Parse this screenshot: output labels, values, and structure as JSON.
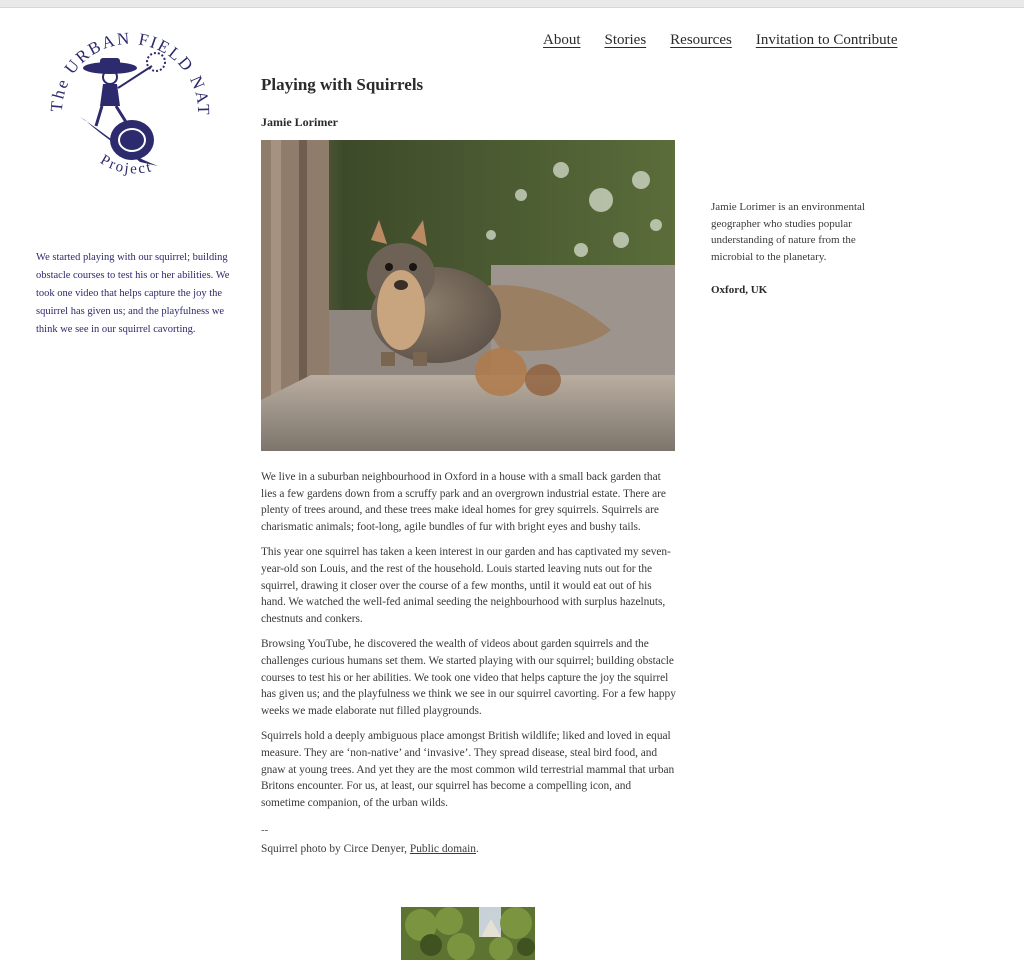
{
  "logo": {
    "arc_top": "The URBAN FIELD NATURALIST",
    "arc_bottom": "Project",
    "colors": {
      "ink": "#2d2a6d"
    }
  },
  "nav": [
    {
      "label": "About"
    },
    {
      "label": "Stories"
    },
    {
      "label": "Resources"
    },
    {
      "label": "Invitation to Contribute"
    }
  ],
  "sidebar_left": {
    "text": "We started playing with our squirrel; building obstacle courses to test his or her abilities. We took one video that helps capture the joy the squirrel has given us; and the playfulness we think we see in our squirrel cavorting."
  },
  "article": {
    "title": "Playing with Squirrels",
    "author": "Jamie Lorimer",
    "hero_image": "squirrel-on-wall-photo",
    "paragraphs": [
      "We live in a suburban neighbourhood in Oxford in a house with a small back garden that lies a few gardens down from a scruffy park and an overgrown industrial estate. There are plenty of trees around, and these trees make ideal homes for grey squirrels. Squirrels are charismatic animals; foot-long, agile bundles of fur with bright eyes and bushy tails.",
      "This year one squirrel has taken a keen interest in our garden and has captivated my seven-year-old son Louis, and the rest of the household. Louis started leaving nuts out for the squirrel, drawing it closer over the course of a few months, until it would eat out of his hand. We watched the well-fed animal seeding the neighbourhood with surplus hazelnuts, chestnuts and conkers.",
      "Browsing YouTube, he discovered the wealth of videos about garden squirrels and the challenges curious humans set them. We started playing with our squirrel; building obstacle courses to test his or her abilities. We took one video that helps capture the joy the squirrel has given us; and the playfulness we think we see in our squirrel cavorting. For a few happy weeks we made elaborate nut filled playgrounds.",
      "Squirrels hold a deeply ambiguous place amongst British wildlife; liked and loved in equal measure. They are ‘non-native’ and ‘invasive’. They spread disease, steal bird food, and gnaw at young trees. And yet they are the most common wild terrestrial mammal that urban Britons encounter. For us, at least, our squirrel has become a compelling icon, and sometime companion, of the urban wilds."
    ],
    "separator": "--",
    "credit_prefix": "Squirrel photo by Circe Denyer, ",
    "credit_link": "Public domain",
    "credit_suffix": "."
  },
  "sidebar_right": {
    "bio": "Jamie Lorimer is an environmental geographer who studies popular understanding of nature from the microbial to the planetary.",
    "location": "Oxford, UK"
  },
  "thumbnail": {
    "image": "garden-trees-thumbnail"
  }
}
